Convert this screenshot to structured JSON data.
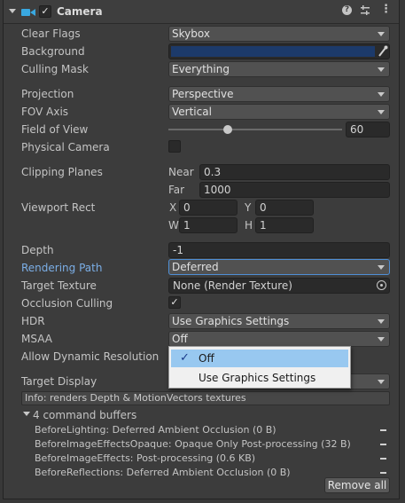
{
  "header": {
    "title": "Camera"
  },
  "fields": {
    "clear_flags": {
      "label": "Clear Flags",
      "value": "Skybox"
    },
    "background": {
      "label": "Background",
      "color": "#1c3a6a"
    },
    "culling_mask": {
      "label": "Culling Mask",
      "value": "Everything"
    },
    "projection": {
      "label": "Projection",
      "value": "Perspective"
    },
    "fov_axis": {
      "label": "FOV Axis",
      "value": "Vertical"
    },
    "field_of_view": {
      "label": "Field of View",
      "value": "60"
    },
    "physical_camera": {
      "label": "Physical Camera",
      "checked": false
    },
    "clipping_planes": {
      "label": "Clipping Planes",
      "near_label": "Near",
      "near": "0.3",
      "far_label": "Far",
      "far": "1000"
    },
    "viewport_rect": {
      "label": "Viewport Rect",
      "x_label": "X",
      "x": "0",
      "y_label": "Y",
      "y": "0",
      "w_label": "W",
      "w": "1",
      "h_label": "H",
      "h": "1"
    },
    "depth": {
      "label": "Depth",
      "value": "-1"
    },
    "rendering_path": {
      "label": "Rendering Path",
      "value": "Deferred"
    },
    "target_texture": {
      "label": "Target Texture",
      "value": "None (Render Texture)"
    },
    "occlusion_culling": {
      "label": "Occlusion Culling",
      "checked": true
    },
    "hdr": {
      "label": "HDR",
      "value": "Use Graphics Settings"
    },
    "msaa": {
      "label": "MSAA",
      "value": "Off"
    },
    "allow_dynamic_resolution": {
      "label": "Allow Dynamic Resolution"
    },
    "target_display": {
      "label": "Target Display"
    }
  },
  "info": "Info: renders Depth & MotionVectors textures",
  "command_buffers": {
    "title": "4 command buffers",
    "items": [
      "BeforeLighting: Deferred Ambient Occlusion (0 B)",
      "BeforeImageEffectsOpaque: Opaque Only Post-processing (32 B)",
      "BeforeImageEffects: Post-processing (0.6 KB)",
      "BeforeReflections: Deferred Ambient Occlusion (0 B)"
    ],
    "remove_all_label": "Remove all"
  },
  "msaa_popup": {
    "options": [
      "Off",
      "Use Graphics Settings"
    ],
    "selected": "Off"
  },
  "colors": {
    "panel_bg": "#3c3c3c",
    "field_bg": "#2a2a2a",
    "dropdown_bg": "#515151",
    "accent_label": "#7baee6",
    "camera_icon": "#39a8e0",
    "popup_selection": "#98c8f0"
  }
}
